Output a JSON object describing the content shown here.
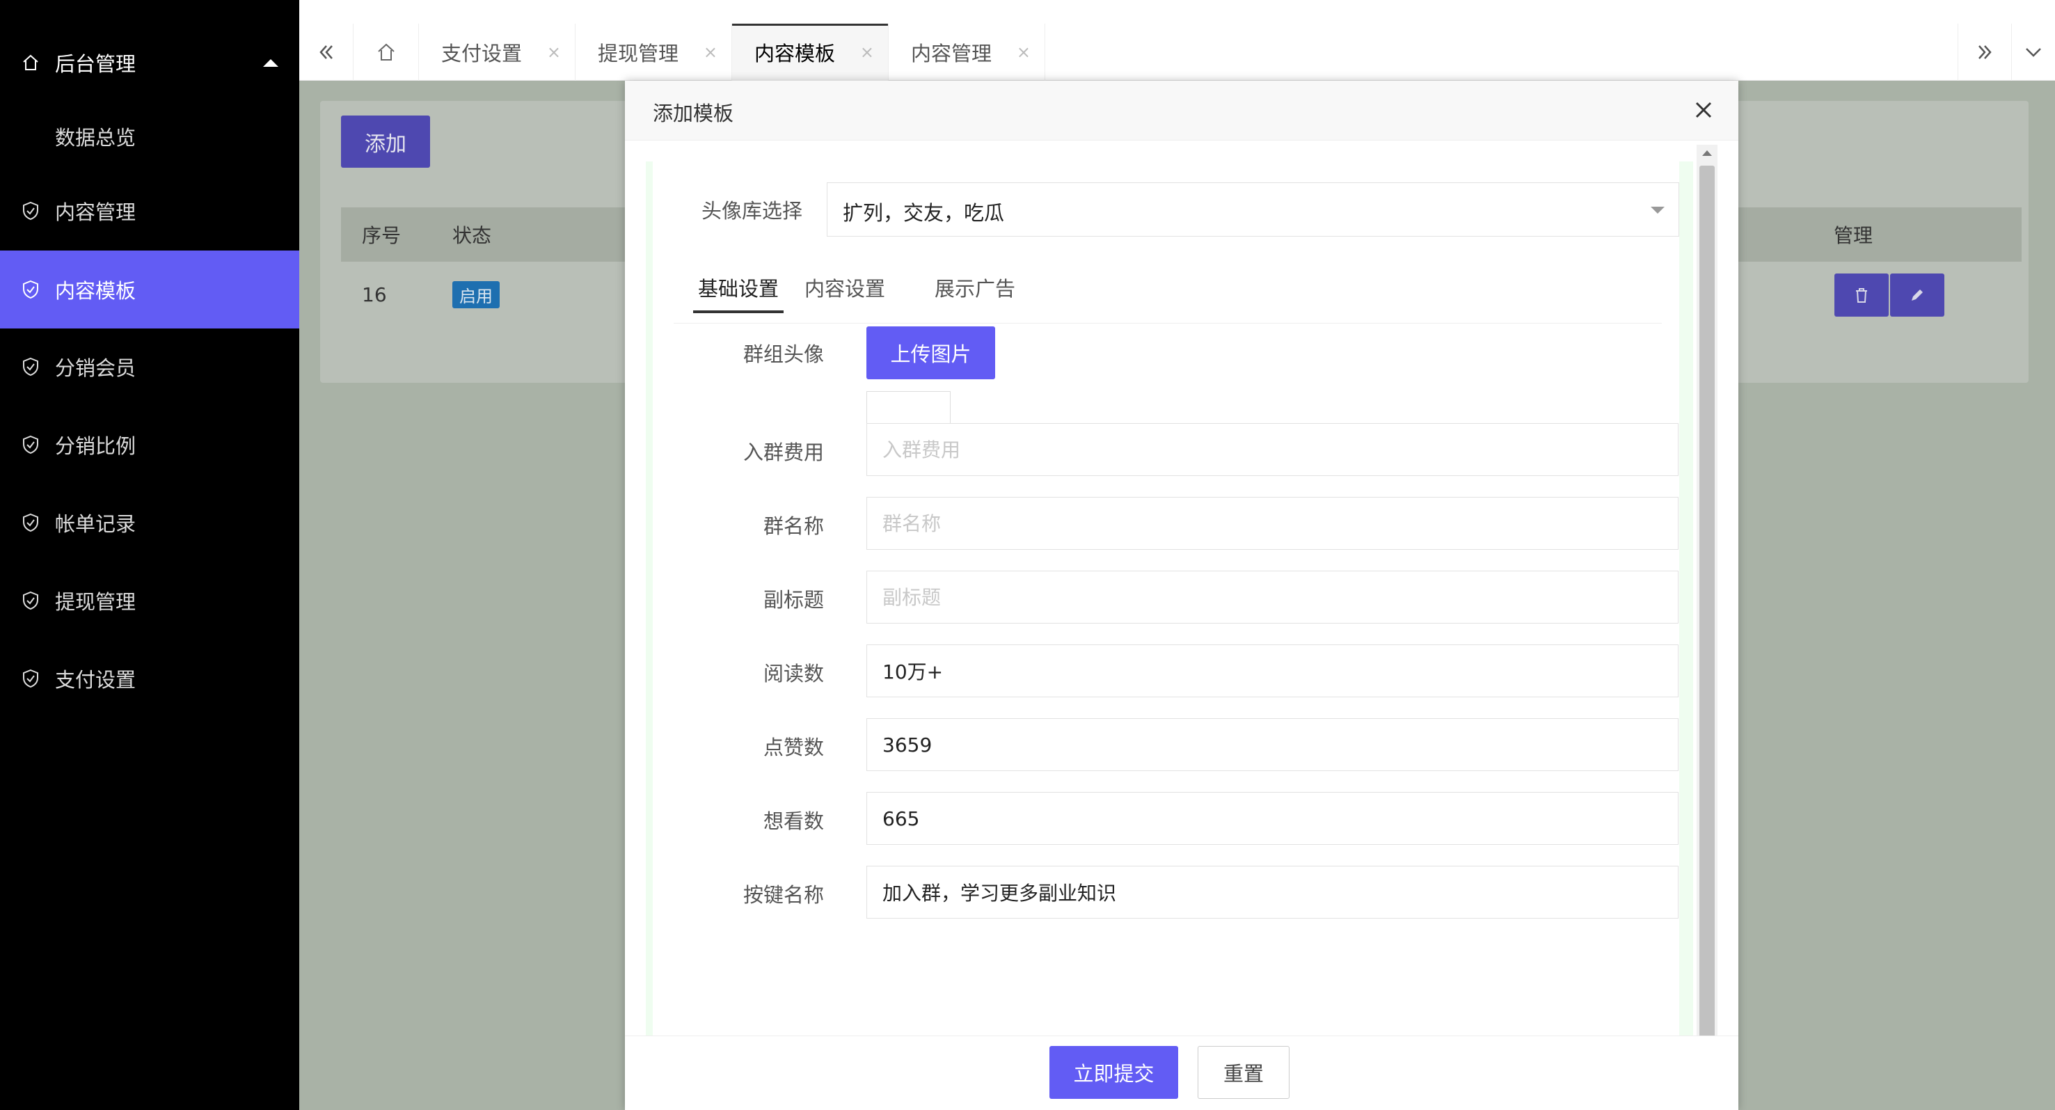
{
  "sidebar": {
    "top_text": "",
    "header": {
      "label": "后台管理",
      "icon": "home-icon"
    },
    "sub_items": [
      {
        "label": "数据总览"
      }
    ],
    "items": [
      {
        "label": "内容管理",
        "icon": "shield-check-icon"
      },
      {
        "label": "内容模板",
        "icon": "shield-check-icon",
        "active": true
      },
      {
        "label": "分销会员",
        "icon": "shield-check-icon"
      },
      {
        "label": "分销比例",
        "icon": "shield-check-icon"
      },
      {
        "label": "帐单记录",
        "icon": "shield-check-icon"
      },
      {
        "label": "提现管理",
        "icon": "shield-check-icon"
      },
      {
        "label": "支付设置",
        "icon": "shield-check-icon"
      }
    ],
    "active_color": "#625cf4"
  },
  "tabbar": {
    "tabs": [
      {
        "label": "支付设置",
        "close": "×"
      },
      {
        "label": "提现管理",
        "close": "×"
      },
      {
        "label": "内容模板",
        "close": "×",
        "active": true
      },
      {
        "label": "内容管理",
        "close": "×"
      }
    ]
  },
  "background": {
    "add_label": "添加",
    "table": {
      "headers": [
        "序号",
        "状态",
        "管理"
      ],
      "rows": [
        {
          "id": "16",
          "status": "启用"
        }
      ]
    }
  },
  "modal": {
    "title": "添加模板",
    "avatar_library_label": "头像库选择",
    "avatar_library_value": "扩列，交友，吃瓜",
    "inner_tabs": [
      "基础设置",
      "内容设置",
      "展示广告"
    ],
    "group_avatar_label": "群组头像",
    "upload_label": "上传图片",
    "fields": [
      {
        "label": "入群费用",
        "value": "",
        "placeholder": "入群费用"
      },
      {
        "label": "群名称",
        "value": "",
        "placeholder": "群名称"
      },
      {
        "label": "副标题",
        "value": "",
        "placeholder": "副标题"
      },
      {
        "label": "阅读数",
        "value": "10万+",
        "placeholder": ""
      },
      {
        "label": "点赞数",
        "value": "3659",
        "placeholder": ""
      },
      {
        "label": "想看数",
        "value": "665",
        "placeholder": ""
      },
      {
        "label": "按键名称",
        "value": "加入群，学习更多副业知识",
        "placeholder": ""
      }
    ],
    "submit_label": "立即提交",
    "reset_label": "重置",
    "primary_color": "#625cf4"
  }
}
